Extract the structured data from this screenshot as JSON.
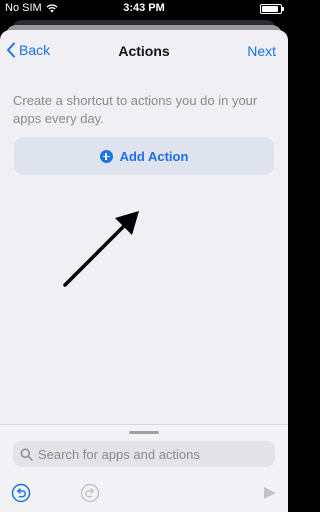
{
  "status_bar": {
    "carrier": "No SIM",
    "time": "3:43 PM"
  },
  "nav": {
    "back_label": "Back",
    "title": "Actions",
    "next_label": "Next"
  },
  "main": {
    "description": "Create a shortcut to actions you do in your apps every day.",
    "add_action_label": "Add Action"
  },
  "search": {
    "placeholder": "Search for apps and actions"
  },
  "toolbar": {
    "icons": [
      "undo-icon",
      "redo-icon",
      "play-icon"
    ]
  },
  "colors": {
    "accent": "#1a73e8",
    "background": "#efeff4",
    "add_button_bg": "#dfe3ee"
  }
}
